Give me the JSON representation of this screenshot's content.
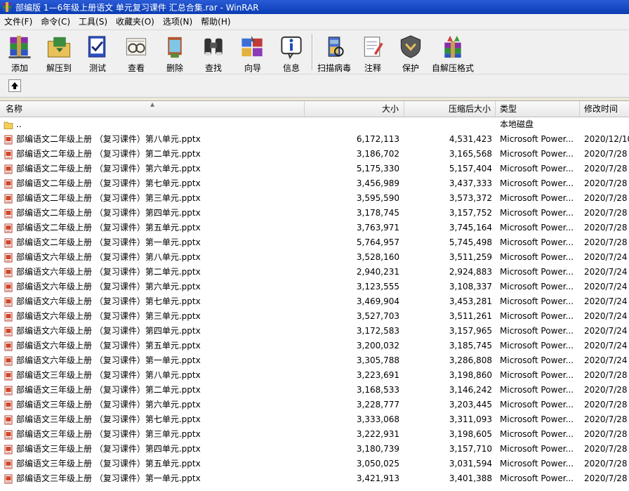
{
  "window": {
    "title": "部编版 1—6年级上册语文 单元复习课件 汇总合集.rar - WinRAR"
  },
  "menu": [
    "文件(F)",
    "命令(C)",
    "工具(S)",
    "收藏夹(O)",
    "选项(N)",
    "帮助(H)"
  ],
  "toolbar": [
    {
      "label": "添加",
      "icon": "add-archive-icon"
    },
    {
      "label": "解压到",
      "icon": "extract-to-icon"
    },
    {
      "label": "测试",
      "icon": "test-icon"
    },
    {
      "label": "查看",
      "icon": "view-icon"
    },
    {
      "label": "删除",
      "icon": "delete-icon"
    },
    {
      "label": "查找",
      "icon": "find-icon"
    },
    {
      "label": "向导",
      "icon": "wizard-icon"
    },
    {
      "label": "信息",
      "icon": "info-icon"
    },
    {
      "label": "扫描病毒",
      "icon": "virus-scan-icon"
    },
    {
      "label": "注释",
      "icon": "comment-icon"
    },
    {
      "label": "保护",
      "icon": "protect-icon"
    },
    {
      "label": "自解压格式",
      "icon": "sfx-icon"
    }
  ],
  "columns": {
    "name": "名称",
    "size": "大小",
    "packed": "压缩后大小",
    "type": "类型",
    "modified": "修改时间"
  },
  "parent_row": {
    "name": "..",
    "type": "本地磁盘"
  },
  "files": [
    {
      "name": "部编语文二年级上册 （复习课件）第八单元.pptx",
      "size": "6,172,113",
      "packed": "4,531,423",
      "type": "Microsoft Power...",
      "modified": "2020/12/10"
    },
    {
      "name": "部编语文二年级上册 （复习课件）第二单元.pptx",
      "size": "3,186,702",
      "packed": "3,165,568",
      "type": "Microsoft Power...",
      "modified": "2020/7/28"
    },
    {
      "name": "部编语文二年级上册 （复习课件）第六单元.pptx",
      "size": "5,175,330",
      "packed": "5,157,404",
      "type": "Microsoft Power...",
      "modified": "2020/7/28"
    },
    {
      "name": "部编语文二年级上册 （复习课件）第七单元.pptx",
      "size": "3,456,989",
      "packed": "3,437,333",
      "type": "Microsoft Power...",
      "modified": "2020/7/28"
    },
    {
      "name": "部编语文二年级上册 （复习课件）第三单元.pptx",
      "size": "3,595,590",
      "packed": "3,573,372",
      "type": "Microsoft Power...",
      "modified": "2020/7/28"
    },
    {
      "name": "部编语文二年级上册 （复习课件）第四单元.pptx",
      "size": "3,178,745",
      "packed": "3,157,752",
      "type": "Microsoft Power...",
      "modified": "2020/7/28"
    },
    {
      "name": "部编语文二年级上册 （复习课件）第五单元.pptx",
      "size": "3,763,971",
      "packed": "3,745,164",
      "type": "Microsoft Power...",
      "modified": "2020/7/28"
    },
    {
      "name": "部编语文二年级上册 （复习课件）第一单元.pptx",
      "size": "5,764,957",
      "packed": "5,745,498",
      "type": "Microsoft Power...",
      "modified": "2020/7/28"
    },
    {
      "name": "部编语文六年级上册 （复习课件）第八单元.pptx",
      "size": "3,528,160",
      "packed": "3,511,259",
      "type": "Microsoft Power...",
      "modified": "2020/7/24"
    },
    {
      "name": "部编语文六年级上册 （复习课件）第二单元.pptx",
      "size": "2,940,231",
      "packed": "2,924,883",
      "type": "Microsoft Power...",
      "modified": "2020/7/24"
    },
    {
      "name": "部编语文六年级上册 （复习课件）第六单元.pptx",
      "size": "3,123,555",
      "packed": "3,108,337",
      "type": "Microsoft Power...",
      "modified": "2020/7/24"
    },
    {
      "name": "部编语文六年级上册 （复习课件）第七单元.pptx",
      "size": "3,469,904",
      "packed": "3,453,281",
      "type": "Microsoft Power...",
      "modified": "2020/7/24"
    },
    {
      "name": "部编语文六年级上册 （复习课件）第三单元.pptx",
      "size": "3,527,703",
      "packed": "3,511,261",
      "type": "Microsoft Power...",
      "modified": "2020/7/24"
    },
    {
      "name": "部编语文六年级上册 （复习课件）第四单元.pptx",
      "size": "3,172,583",
      "packed": "3,157,965",
      "type": "Microsoft Power...",
      "modified": "2020/7/24"
    },
    {
      "name": "部编语文六年级上册 （复习课件）第五单元.pptx",
      "size": "3,200,032",
      "packed": "3,185,745",
      "type": "Microsoft Power...",
      "modified": "2020/7/24"
    },
    {
      "name": "部编语文六年级上册 （复习课件）第一单元.pptx",
      "size": "3,305,788",
      "packed": "3,286,808",
      "type": "Microsoft Power...",
      "modified": "2020/7/24"
    },
    {
      "name": "部编语文三年级上册 （复习课件）第八单元.pptx",
      "size": "3,223,691",
      "packed": "3,198,860",
      "type": "Microsoft Power...",
      "modified": "2020/7/28"
    },
    {
      "name": "部编语文三年级上册 （复习课件）第二单元.pptx",
      "size": "3,168,533",
      "packed": "3,146,242",
      "type": "Microsoft Power...",
      "modified": "2020/7/28"
    },
    {
      "name": "部编语文三年级上册 （复习课件）第六单元.pptx",
      "size": "3,228,777",
      "packed": "3,203,445",
      "type": "Microsoft Power...",
      "modified": "2020/7/28"
    },
    {
      "name": "部编语文三年级上册 （复习课件）第七单元.pptx",
      "size": "3,333,068",
      "packed": "3,311,093",
      "type": "Microsoft Power...",
      "modified": "2020/7/28"
    },
    {
      "name": "部编语文三年级上册 （复习课件）第三单元.pptx",
      "size": "3,222,931",
      "packed": "3,198,605",
      "type": "Microsoft Power...",
      "modified": "2020/7/28"
    },
    {
      "name": "部编语文三年级上册 （复习课件）第四单元.pptx",
      "size": "3,180,739",
      "packed": "3,157,710",
      "type": "Microsoft Power...",
      "modified": "2020/7/28"
    },
    {
      "name": "部编语文三年级上册 （复习课件）第五单元.pptx",
      "size": "3,050,025",
      "packed": "3,031,594",
      "type": "Microsoft Power...",
      "modified": "2020/7/28"
    },
    {
      "name": "部编语文三年级上册 （复习课件）第一单元.pptx",
      "size": "3,421,913",
      "packed": "3,401,388",
      "type": "Microsoft Power...",
      "modified": "2020/7/28"
    }
  ]
}
